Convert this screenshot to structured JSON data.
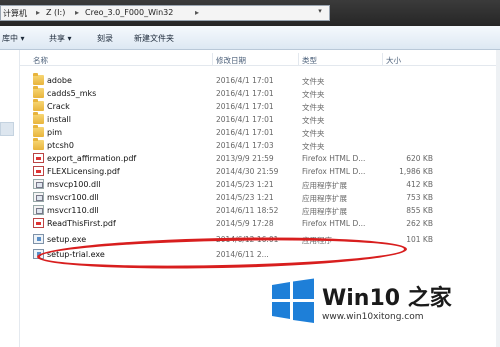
{
  "address_bar": {
    "breadcrumbs": [
      "计算机",
      "Z (I:)",
      "Creo_3.0_F000_Win32"
    ]
  },
  "toolbar": {
    "items": [
      {
        "label": "库中 ▾"
      },
      {
        "label": "共享 ▾"
      },
      {
        "label": "刻录"
      },
      {
        "label": "新建文件夹"
      }
    ]
  },
  "columns": {
    "name": "名称",
    "date": "修改日期",
    "type": "类型",
    "size": "大小"
  },
  "files": [
    {
      "name": "adobe",
      "date": "2016/4/1 17:01",
      "type": "文件夹",
      "size": "",
      "icon": "folder-icon"
    },
    {
      "name": "cadds5_mks",
      "date": "2016/4/1 17:01",
      "type": "文件夹",
      "size": "",
      "icon": "folder-icon"
    },
    {
      "name": "Crack",
      "date": "2016/4/1 17:01",
      "type": "文件夹",
      "size": "",
      "icon": "folder-icon"
    },
    {
      "name": "install",
      "date": "2016/4/1 17:01",
      "type": "文件夹",
      "size": "",
      "icon": "folder-icon"
    },
    {
      "name": "pim",
      "date": "2016/4/1 17:01",
      "type": "文件夹",
      "size": "",
      "icon": "folder-icon"
    },
    {
      "name": "ptcsh0",
      "date": "2016/4/1 17:03",
      "type": "文件夹",
      "size": "",
      "icon": "folder-icon"
    },
    {
      "name": "export_affirmation.pdf",
      "date": "2013/9/9 21:59",
      "type": "Firefox HTML D...",
      "size": "620 KB",
      "icon": "pdf-file-icon"
    },
    {
      "name": "FLEXLicensing.pdf",
      "date": "2014/4/30 21:59",
      "type": "Firefox HTML D...",
      "size": "1,986 KB",
      "icon": "pdf-file-icon"
    },
    {
      "name": "msvcp100.dll",
      "date": "2014/5/23 1:21",
      "type": "应用程序扩展",
      "size": "412 KB",
      "icon": "dll-file-icon"
    },
    {
      "name": "msvcr100.dll",
      "date": "2014/5/23 1:21",
      "type": "应用程序扩展",
      "size": "753 KB",
      "icon": "dll-file-icon"
    },
    {
      "name": "msvcr110.dll",
      "date": "2014/6/11 18:52",
      "type": "应用程序扩展",
      "size": "855 KB",
      "icon": "dll-file-icon"
    },
    {
      "name": "ReadThisFirst.pdf",
      "date": "2014/5/9 17:28",
      "type": "Firefox HTML D...",
      "size": "262 KB",
      "icon": "pdf-file-icon"
    },
    {
      "name": "setup.exe",
      "date": "2014/6/12 16:01",
      "type": "应用程序",
      "size": "101 KB",
      "icon": "exe-file-icon"
    },
    {
      "name": "setup-trial.exe",
      "date": "2014/6/11 2...",
      "type": "",
      "size": "",
      "icon": "exe-file-icon"
    }
  ],
  "watermark": {
    "title": "Win10 之家",
    "url": "www.win10xitong.com",
    "logo_color": "#1e7fd8"
  },
  "colors": {
    "annotation": "#d81e1e"
  }
}
